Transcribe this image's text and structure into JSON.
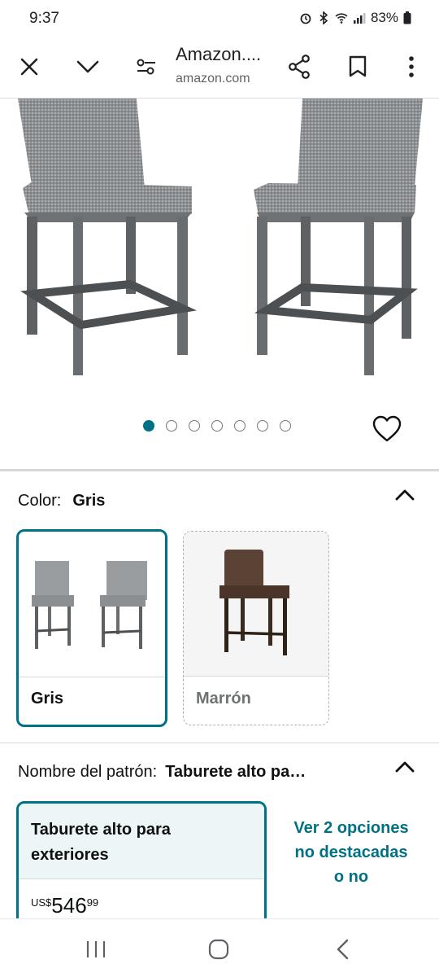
{
  "status_bar": {
    "time": "9:37",
    "battery": "83%"
  },
  "browser": {
    "page_title": "Amazon....",
    "url": "amazon.com"
  },
  "gallery": {
    "image_count": 7,
    "active_index": 0
  },
  "color": {
    "label": "Color:",
    "selected_value": "Gris",
    "options": [
      {
        "name": "Gris",
        "selected": true
      },
      {
        "name": "Marrón",
        "selected": false
      }
    ]
  },
  "pattern": {
    "label": "Nombre del patrón:",
    "selected_value": "Taburete alto pa…",
    "card_title": "Taburete alto para exteriores",
    "price_currency": "US$",
    "price_whole": "546",
    "price_fraction": "99",
    "more_options_text": "Ver 2 opciones no destacadas o no"
  },
  "colors": {
    "accent": "#007185",
    "selected_bg": "#edf6f7"
  }
}
